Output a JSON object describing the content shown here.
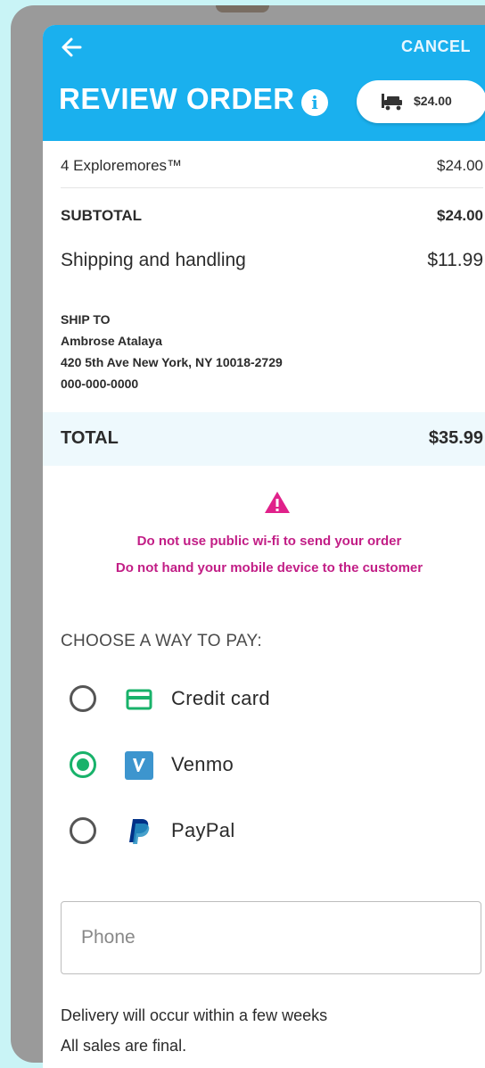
{
  "header": {
    "back_icon": "arrow-left-icon",
    "cancel_label": "CANCEL",
    "title": "REVIEW ORDER",
    "info_icon": "info-icon",
    "cart_total": "$24.00",
    "cart_icon": "cart-icon"
  },
  "order": {
    "item_label": "4 Exploremores™",
    "item_price": "$24.00",
    "subtotal_label": "SUBTOTAL",
    "subtotal_value": "$24.00",
    "shipping_label": "Shipping and handling",
    "shipping_value": "$11.99"
  },
  "ship_to": {
    "label": "SHIP TO",
    "name": "Ambrose Atalaya",
    "address": "420 5th Ave New York, NY 10018-2729",
    "phone": "000-000-0000"
  },
  "total": {
    "label": "TOTAL",
    "value": "$35.99"
  },
  "warnings": {
    "icon": "warning-triangle-icon",
    "line1": "Do not use public wi-fi to send your order",
    "line2": "Do not hand your mobile device to the customer",
    "color": "#c21e86"
  },
  "payment": {
    "heading": "CHOOSE A WAY TO PAY:",
    "options": [
      {
        "label": "Credit card",
        "icon": "credit-card-icon",
        "selected": false
      },
      {
        "label": "Venmo",
        "icon": "venmo-icon",
        "selected": true
      },
      {
        "label": "PayPal",
        "icon": "paypal-icon",
        "selected": false
      }
    ]
  },
  "phone_field": {
    "placeholder": "Phone",
    "value": ""
  },
  "notes": {
    "line1": "Delivery will occur within a few weeks",
    "line2": "All sales are final."
  },
  "colors": {
    "header": "#1ab0ee",
    "selected": "#18b26a",
    "venmo": "#3d95ce",
    "paypal": "#003087"
  }
}
